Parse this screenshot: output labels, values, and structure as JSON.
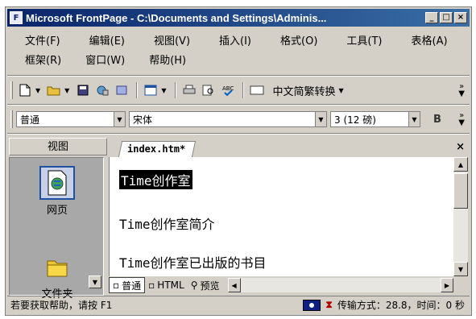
{
  "titlebar": {
    "title": "Microsoft FrontPage - C:\\Documents and Settings\\Adminis...",
    "buttons": {
      "minimize": "_",
      "maximize": "□",
      "close": "×"
    }
  },
  "menu": {
    "row1": [
      "文件(F)",
      "编辑(E)",
      "视图(V)",
      "插入(I)",
      "格式(O)",
      "工具(T)",
      "表格(A)"
    ],
    "row2": [
      "框架(R)",
      "窗口(W)",
      "帮助(H)"
    ]
  },
  "toolbar": {
    "convert_label": "中文简繁转换",
    "more": "»"
  },
  "format_bar": {
    "style": "普通",
    "font": "宋体",
    "size": "3 (12 磅)",
    "bold": "B"
  },
  "views": {
    "header": "视图",
    "items": [
      {
        "label": "网页",
        "icon": "page-icon",
        "selected": true
      },
      {
        "label": "文件夹",
        "icon": "folder-icon",
        "selected": false
      }
    ]
  },
  "editor": {
    "tab": "index.htm*",
    "close": "×",
    "lines": [
      "Time创作室",
      "Time创作室简介",
      "Time创作室已出版的书目"
    ],
    "modes": [
      "普通",
      "HTML",
      "预览"
    ]
  },
  "status": {
    "help": "若要获取帮助，请按 F1",
    "transfer": "传输方式：28.8，时间：0 秒"
  },
  "colors": {
    "titlebar": "#0a246a",
    "chrome": "#d4d0c8",
    "selection": "#000000"
  }
}
